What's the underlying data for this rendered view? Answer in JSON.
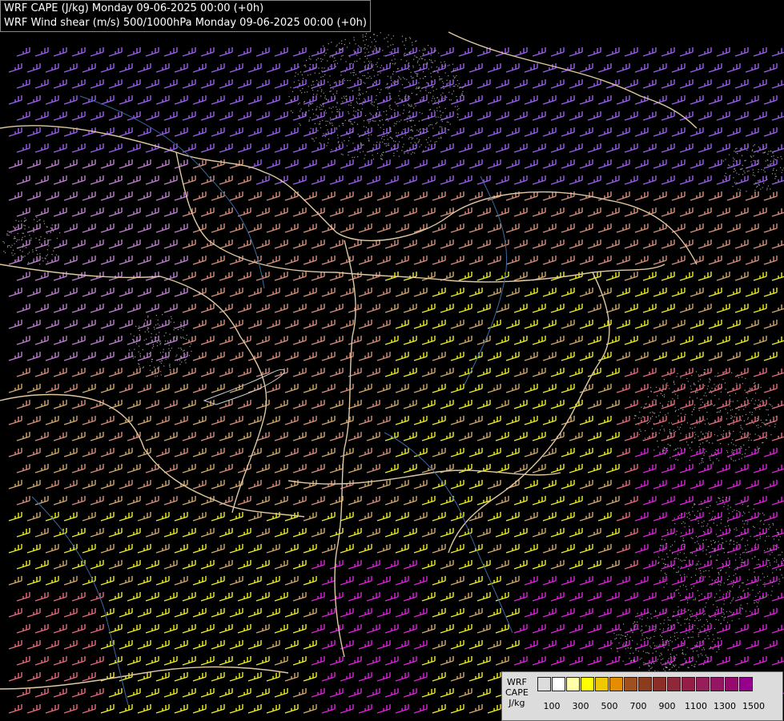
{
  "titles": {
    "line1": "WRF CAPE (J/kg) Monday 09-06-2025 00:00 (+0h)",
    "line2": "WRF Wind shear (m/s) 500/1000hPa Monday 09-06-2025 00:00 (+0h)"
  },
  "legend": {
    "label_model": "WRF",
    "label_field": "CAPE",
    "label_unit": "J/kg",
    "colors": [
      "#dcdcdc",
      "#ffffff",
      "#ffffaa",
      "#ffff00",
      "#f0c800",
      "#e68c00",
      "#a0501e",
      "#8c3c1e",
      "#8c2d28",
      "#8c2837",
      "#961e46",
      "#961e5a",
      "#961464",
      "#960a6e",
      "#96008c"
    ],
    "ticks": [
      "100",
      "300",
      "500",
      "700",
      "900",
      "1100",
      "1300",
      "1500"
    ]
  },
  "map": {
    "barb_colors": {
      "violet": "#9b5ff0",
      "lilac": "#c07fd0",
      "salmon": "#d9907a",
      "tan": "#d4a86a",
      "yellow": "#f0f020",
      "pink": "#e86a7a",
      "magenta": "#e020e0"
    },
    "border_color": "#e0c8a0",
    "river_color": "#3a6aa0"
  }
}
